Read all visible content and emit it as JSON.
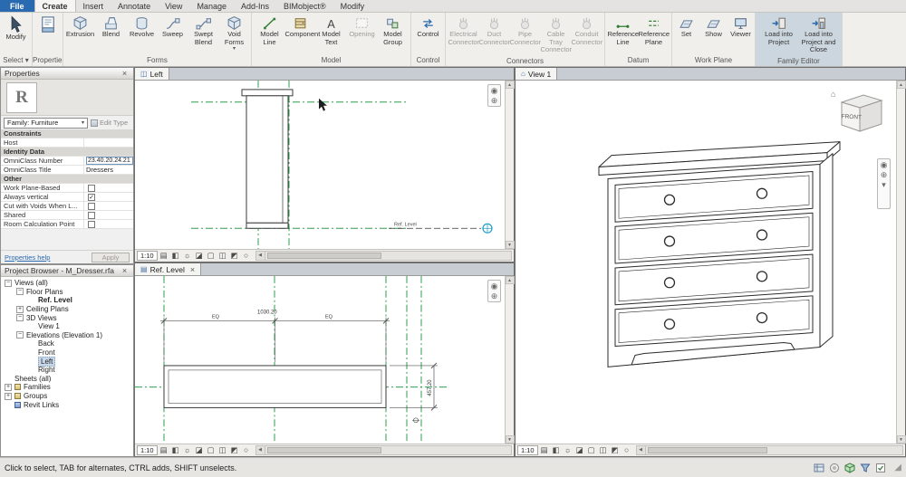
{
  "glyphs": {
    "close": "×",
    "dropdown": "▾",
    "up": "▲",
    "down": "▼",
    "left": "◀",
    "right": "▶",
    "minus": "−",
    "plus": "+",
    "check": "✓",
    "detail": "▤",
    "style": "◧",
    "sun": "☼",
    "shadow": "◪",
    "crop": "▢",
    "cropvis": "◫",
    "hide": "◩",
    "reveal": "○",
    "wheel": "◉",
    "zoom": "⊕",
    "home": "⌂",
    "grip": "◢"
  },
  "tabs": {
    "file": "File",
    "create": "Create",
    "insert": "Insert",
    "annotate": "Annotate",
    "view": "View",
    "manage": "Manage",
    "addins": "Add-Ins",
    "bimobject": "BIMobject®",
    "modify": "Modify"
  },
  "ribbon": {
    "select_panel": {
      "modify": "Modify",
      "label": "Select ▾"
    },
    "properties_panel": {
      "label": "Properties"
    },
    "forms": {
      "label": "Forms",
      "extrusion": "Extrusion",
      "blend": "Blend",
      "revolve": "Revolve",
      "sweep": "Sweep",
      "swept_blend": "Swept Blend",
      "void_forms": "Void Forms"
    },
    "model": {
      "label": "Model",
      "model_line": "Model Line",
      "component": "Component",
      "model_text": "Model Text",
      "opening": "Opening",
      "model_group": "Model Group"
    },
    "control": {
      "label": "Control",
      "control": "Control"
    },
    "connectors": {
      "label": "Connectors",
      "electrical": "Electrical Connector",
      "duct": "Duct Connector",
      "pipe": "Pipe Connector",
      "cable_tray": "Cable Tray Connector",
      "conduit": "Conduit Connector"
    },
    "datum": {
      "label": "Datum",
      "reference_line": "Reference Line",
      "reference_plane": "Reference Plane"
    },
    "work_plane": {
      "label": "Work Plane",
      "set": "Set",
      "show": "Show",
      "viewer": "Viewer"
    },
    "family_editor": {
      "label": "Family Editor",
      "load": "Load into Project",
      "load_close": "Load into Project and Close"
    }
  },
  "properties": {
    "title": "Properties",
    "preview_letter": "R",
    "type_selector": "Family: Furniture",
    "edit_type": "Edit Type",
    "constraints_header": "Constraints",
    "host_label": "Host",
    "identity_header": "Identity Data",
    "omniclass_number_label": "OmniClass Number",
    "omniclass_number_value": "23.40.20.24.21",
    "omniclass_title_label": "OmniClass Title",
    "omniclass_title_value": "Dressers",
    "other_header": "Other",
    "work_plane_based": "Work Plane-Based",
    "always_vertical": "Always vertical",
    "cut_with_voids": "Cut with Voids When L...",
    "shared": "Shared",
    "room_calc_point": "Room Calculation Point",
    "help_link": "Properties help",
    "apply": "Apply"
  },
  "browser": {
    "title": "Project Browser - M_Dresser.rfa",
    "views_all": "Views (all)",
    "floor_plans": "Floor Plans",
    "ref_level": "Ref. Level",
    "ceiling_plans": "Ceiling Plans",
    "three_d_views": "3D Views",
    "view_1": "View 1",
    "elevations": "Elevations (Elevation 1)",
    "back": "Back",
    "front": "Front",
    "left": "Left",
    "right": "Right",
    "sheets": "Sheets (all)",
    "families": "Families",
    "groups": "Groups",
    "revit_links": "Revit Links"
  },
  "views": {
    "scale": "1:10",
    "left_tab": "Left",
    "plan_tab": "Ref. Level",
    "v3d_tab": "View 1",
    "viewcube_front": "FRONT",
    "elev": {
      "level_label": "Ref. Level"
    },
    "plan": {
      "dim_total": "1030.20",
      "eq1": "EQ",
      "eq2": "EQ",
      "dim_depth": "457.20"
    }
  },
  "statusbar": {
    "hint": "Click to select, TAB for alternates, CTRL adds, SHIFT unselects."
  },
  "colors": {
    "file_tab": "#2a6ab0",
    "ref_plane_green": "#2f9e4f",
    "family_editor_panel": "#ccd6de",
    "selection_highlight": "#c8d8ea",
    "level_target_blue": "#1a9bc4"
  }
}
